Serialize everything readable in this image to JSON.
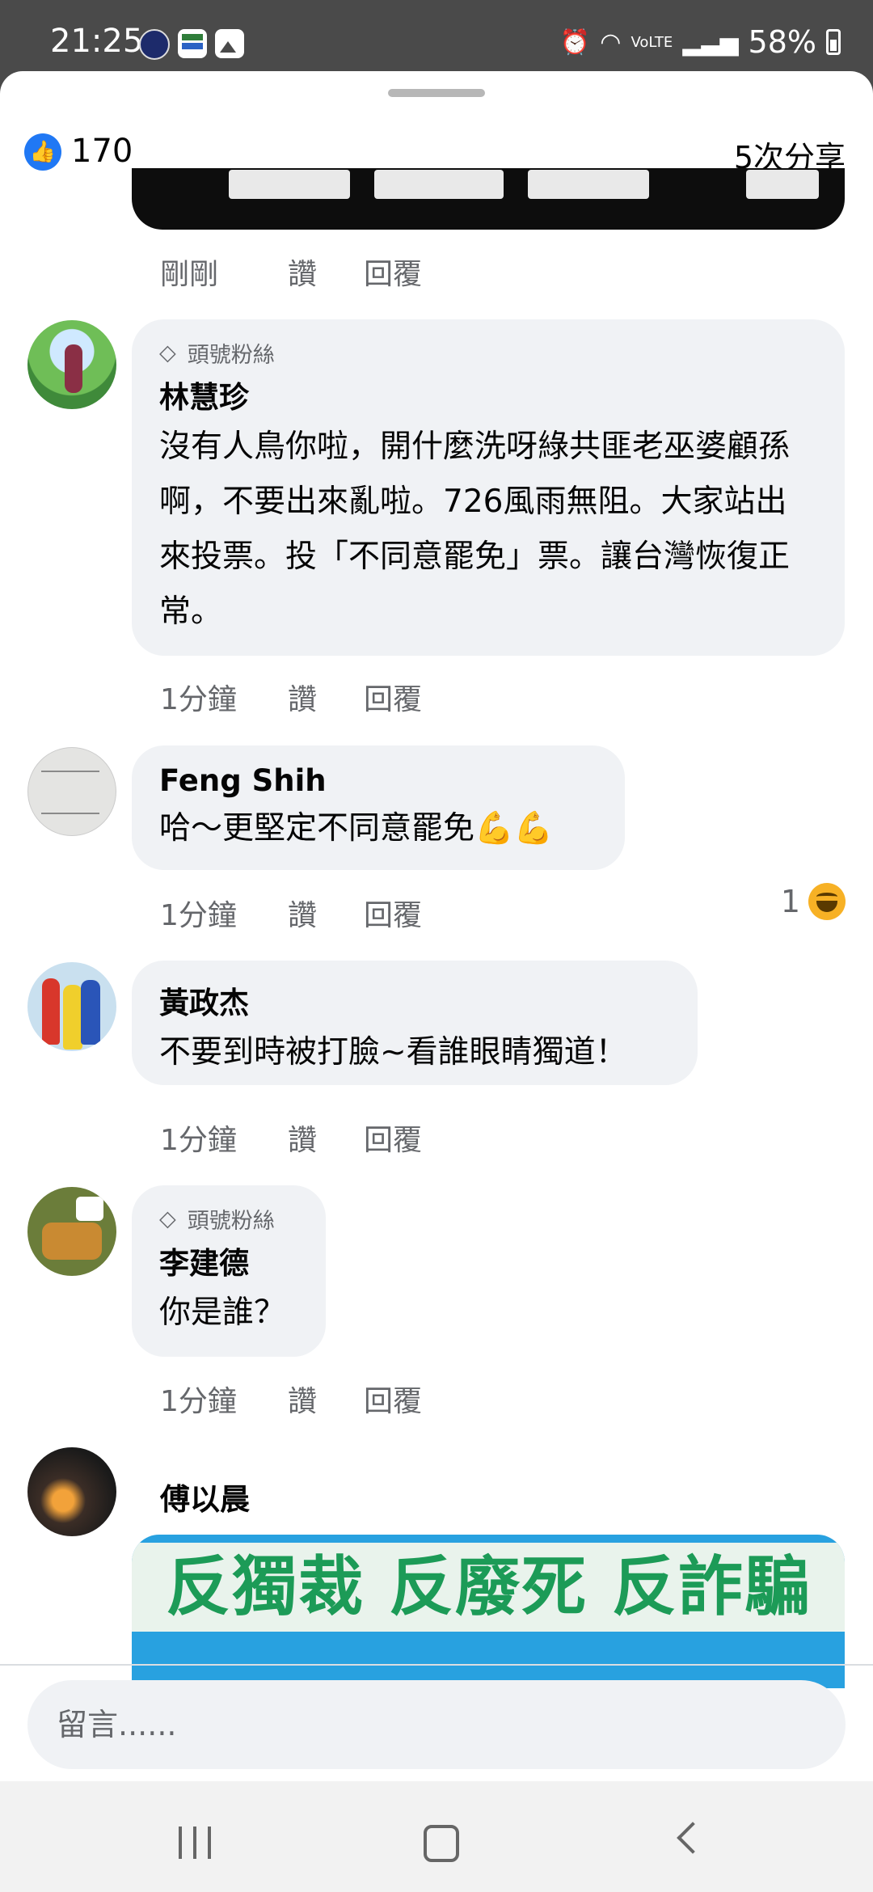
{
  "status_bar": {
    "time": "21:25",
    "battery": "58%",
    "lte_label": "VoLTE"
  },
  "header": {
    "like_count": "170",
    "share_count": "5次分享"
  },
  "first_actions": {
    "time": "剛剛",
    "like": "讚",
    "reply": "回覆"
  },
  "comments": [
    {
      "badge": "頭號粉絲",
      "name": "林慧珍",
      "text": "沒有人鳥你啦，開什麼洗呀綠共匪老巫婆顧孫啊，不要出來亂啦。726風雨無阻。大家站出來投票。投「不同意罷免」票。讓台灣恢復正常。",
      "time": "1分鐘",
      "like": "讚",
      "reply": "回覆"
    },
    {
      "name": "Feng Shih",
      "text": "哈～更堅定不同意罷免💪💪",
      "time": "1分鐘",
      "like": "讚",
      "reply": "回覆",
      "reaction_count": "1"
    },
    {
      "name": "黃政杰",
      "text": "不要到時被打臉~看誰眼睛獨道！",
      "time": "1分鐘",
      "like": "讚",
      "reply": "回覆"
    },
    {
      "badge": "頭號粉絲",
      "name": "李建德",
      "text": "你是誰？",
      "time": "1分鐘",
      "like": "讚",
      "reply": "回覆"
    },
    {
      "name": "傅以晨",
      "image_text": "反獨裁 反廢死 反詐騙"
    }
  ],
  "composer": {
    "placeholder": "留言......"
  },
  "colors": {
    "facebook_blue": "#2078f4",
    "bubble_gray": "#f0f2f5",
    "secondary_text": "#65676b"
  }
}
